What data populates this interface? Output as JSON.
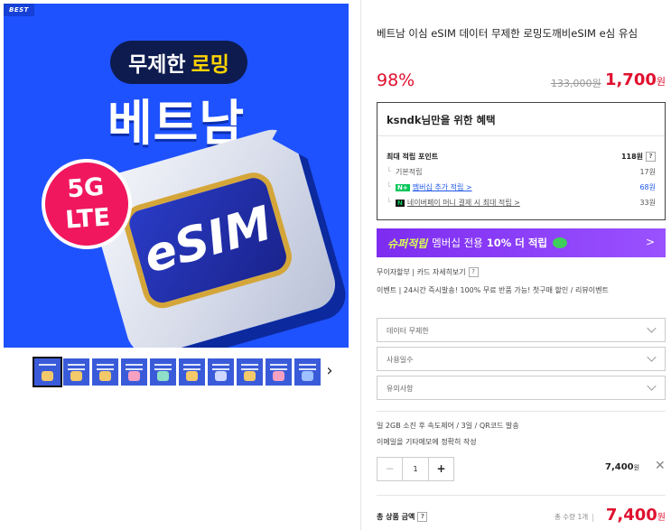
{
  "hero": {
    "badge": "BEST",
    "pill_text": "무제한",
    "pill_highlight": "로밍",
    "title": "베트남",
    "chip_text": "eSIM",
    "lte_line1": "5G",
    "lte_line2": "LTE"
  },
  "product": {
    "title": "베트남 이심 eSIM 데이터 무제한 로밍도깨비eSIM e심 유심",
    "discount": "98%",
    "original_price": "133,000원",
    "sale_price": "1,700",
    "sale_unit": "원"
  },
  "benefit": {
    "heading": "ksndk님만을 위한 혜택",
    "max_label": "최대 적립 포인트",
    "max_amount": "118원",
    "help": "?",
    "basic_label": "기본적립",
    "basic_amount": "17원",
    "membership_badge": "N+",
    "membership_label": "멤버십 추가 적립 >",
    "membership_amount": "68원",
    "npay_badge": "N",
    "npay_label": "네이버페이 머니 결제 시 최대 적립 >",
    "npay_amount": "33원"
  },
  "banner": {
    "brand": "슈퍼적립",
    "text": "멤버십 전용",
    "bold": "10% 더 적립",
    "arrow": ">"
  },
  "info": {
    "installment": "무이자할부 | 카드 자세히보기",
    "help": "?",
    "event": "이벤트 | 24시간 즉시발송! 100% 무료 반품 가능! 첫구매 할인 / 리뷰이벤트"
  },
  "options": [
    {
      "label": "데이터 무제한"
    },
    {
      "label": "사용일수"
    },
    {
      "label": "유의사항"
    }
  ],
  "notes": {
    "line1": "일 2GB 소진 후 속도제어 / 3일 / QR코드 발송",
    "line2": "이메일을 기타메모에 정확히 작성"
  },
  "order": {
    "minus": "−",
    "qty": "1",
    "plus": "+",
    "line_price": "7,400",
    "line_unit": "원",
    "remove": "✕"
  },
  "total": {
    "label": "총 상품 금액",
    "help": "?",
    "qty": "총 수량 1개",
    "price": "7,400",
    "unit": "원"
  },
  "colors": {
    "accent_red": "#e0102f",
    "hero_blue": "#1f52ff",
    "banner_purple": "#7d2cf0"
  }
}
